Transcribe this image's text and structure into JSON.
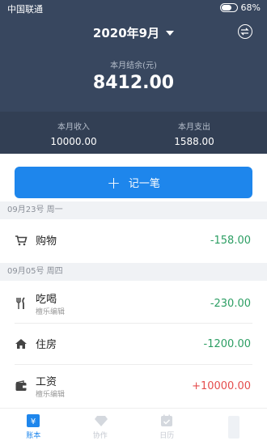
{
  "status_bar": {
    "carrier": "中国联通",
    "battery_percent": "68%",
    "battery_level": 0.68
  },
  "header": {
    "month": "2020年9月",
    "balance_label": "本月结余(元)",
    "balance_value": "8412.00",
    "income_label": "本月收入",
    "income_value": "10000.00",
    "expense_label": "本月支出",
    "expense_value": "1588.00"
  },
  "record_button": {
    "label": "记一笔"
  },
  "groups": [
    {
      "date": "09月23号  周一",
      "items": [
        {
          "icon": "cart-icon",
          "title": "购物",
          "subtitle": "",
          "amount": "-158.00",
          "type": "expense"
        }
      ]
    },
    {
      "date": "09月05号  周四",
      "items": [
        {
          "icon": "fork-knife-icon",
          "title": "吃喝",
          "subtitle": "檀乐编辑",
          "amount": "-230.00",
          "type": "expense"
        },
        {
          "icon": "house-icon",
          "title": "住房",
          "subtitle": "",
          "amount": "-1200.00",
          "type": "expense"
        },
        {
          "icon": "wallet-icon",
          "title": "工资",
          "subtitle": "檀乐编辑",
          "amount": "+10000.00",
          "type": "income"
        }
      ]
    }
  ],
  "tabs": [
    {
      "label": "账本",
      "icon": "ledger-icon",
      "active": true
    },
    {
      "label": "协作",
      "icon": "diamond-icon",
      "active": false
    },
    {
      "label": "日历",
      "icon": "calendar-icon",
      "active": false
    },
    {
      "label": "",
      "icon": "",
      "active": false
    }
  ],
  "colors": {
    "header": "#38475f",
    "accent": "#1e86ec",
    "expense": "#2c9e63",
    "income": "#e54d4d"
  }
}
